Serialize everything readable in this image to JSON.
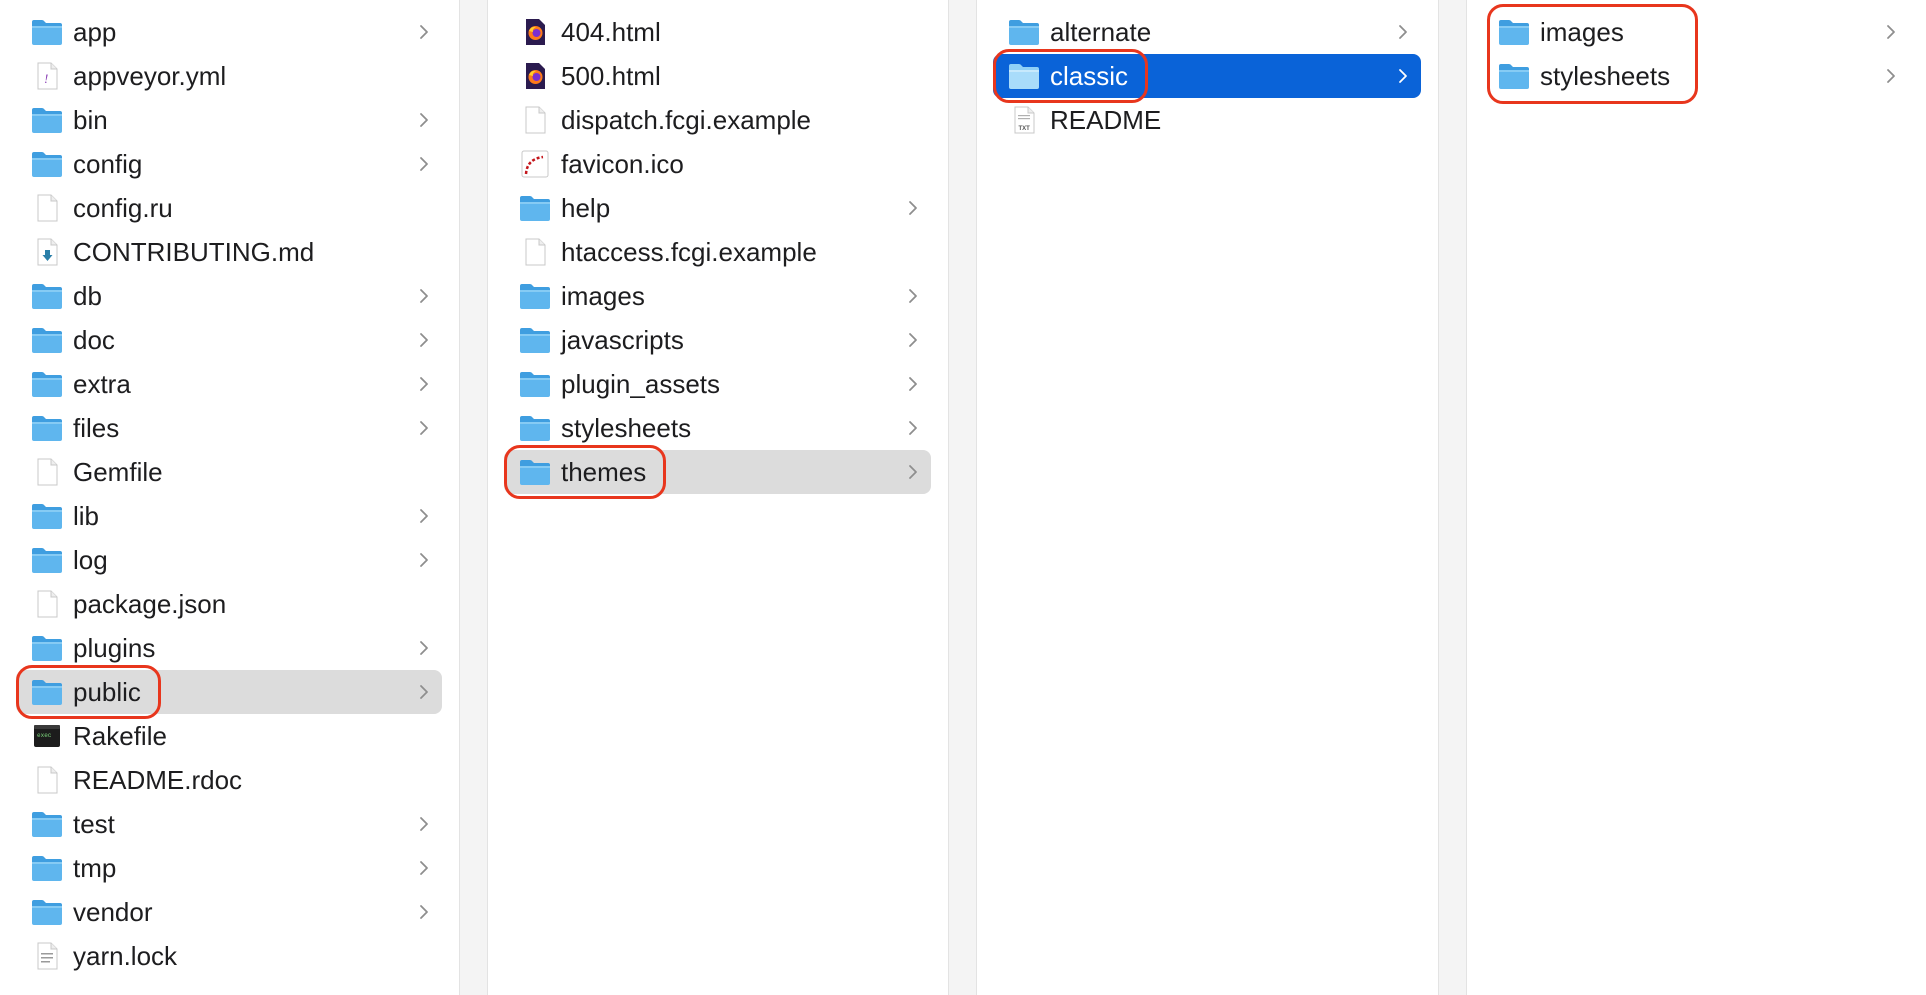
{
  "columns": [
    {
      "items": [
        {
          "label": "app",
          "icon": "folder-icon",
          "folder": true
        },
        {
          "label": "appveyor.yml",
          "icon": "yaml-file-icon",
          "folder": false
        },
        {
          "label": "bin",
          "icon": "folder-icon",
          "folder": true
        },
        {
          "label": "config",
          "icon": "folder-icon",
          "folder": true
        },
        {
          "label": "config.ru",
          "icon": "document-icon",
          "folder": false
        },
        {
          "label": "CONTRIBUTING.md",
          "icon": "markdown-file-icon",
          "folder": false
        },
        {
          "label": "db",
          "icon": "folder-icon",
          "folder": true
        },
        {
          "label": "doc",
          "icon": "folder-icon",
          "folder": true
        },
        {
          "label": "extra",
          "icon": "folder-icon",
          "folder": true
        },
        {
          "label": "files",
          "icon": "folder-icon",
          "folder": true
        },
        {
          "label": "Gemfile",
          "icon": "document-icon",
          "folder": false
        },
        {
          "label": "lib",
          "icon": "folder-icon",
          "folder": true
        },
        {
          "label": "log",
          "icon": "folder-icon",
          "folder": true
        },
        {
          "label": "package.json",
          "icon": "document-icon",
          "folder": false
        },
        {
          "label": "plugins",
          "icon": "folder-icon",
          "folder": true
        },
        {
          "label": "public",
          "icon": "folder-icon",
          "folder": true,
          "selected": "gray",
          "highlighted": true
        },
        {
          "label": "Rakefile",
          "icon": "terminal-file-icon",
          "folder": false
        },
        {
          "label": "README.rdoc",
          "icon": "document-icon",
          "folder": false
        },
        {
          "label": "test",
          "icon": "folder-icon",
          "folder": true
        },
        {
          "label": "tmp",
          "icon": "folder-icon",
          "folder": true
        },
        {
          "label": "vendor",
          "icon": "folder-icon",
          "folder": true
        },
        {
          "label": "yarn.lock",
          "icon": "text-file-icon",
          "folder": false
        }
      ]
    },
    {
      "items": [
        {
          "label": "404.html",
          "icon": "firefox-html-icon",
          "folder": false
        },
        {
          "label": "500.html",
          "icon": "firefox-html-icon",
          "folder": false
        },
        {
          "label": "dispatch.fcgi.example",
          "icon": "document-icon",
          "folder": false
        },
        {
          "label": "favicon.ico",
          "icon": "rails-favicon-icon",
          "folder": false
        },
        {
          "label": "help",
          "icon": "folder-icon",
          "folder": true
        },
        {
          "label": "htaccess.fcgi.example",
          "icon": "document-icon",
          "folder": false
        },
        {
          "label": "images",
          "icon": "folder-icon",
          "folder": true
        },
        {
          "label": "javascripts",
          "icon": "folder-icon",
          "folder": true
        },
        {
          "label": "plugin_assets",
          "icon": "folder-icon",
          "folder": true
        },
        {
          "label": "stylesheets",
          "icon": "folder-icon",
          "folder": true
        },
        {
          "label": "themes",
          "icon": "folder-icon",
          "folder": true,
          "selected": "gray",
          "highlighted": true
        }
      ]
    },
    {
      "items": [
        {
          "label": "alternate",
          "icon": "folder-icon",
          "folder": true
        },
        {
          "label": "classic",
          "icon": "folder-icon",
          "folder": true,
          "selected": "blue",
          "highlighted": true
        },
        {
          "label": "README",
          "icon": "txt-file-icon",
          "folder": false
        }
      ]
    },
    {
      "items": [
        {
          "label": "images",
          "icon": "folder-icon",
          "folder": true
        },
        {
          "label": "stylesheets",
          "icon": "folder-icon",
          "folder": true
        }
      ],
      "highlighted_group": true
    }
  ],
  "colors": {
    "selection_blue": "#0a63d8",
    "selection_gray": "#dcdcdc",
    "folder_blue": "#5fb6ee",
    "annotation_red": "#e8361d"
  }
}
